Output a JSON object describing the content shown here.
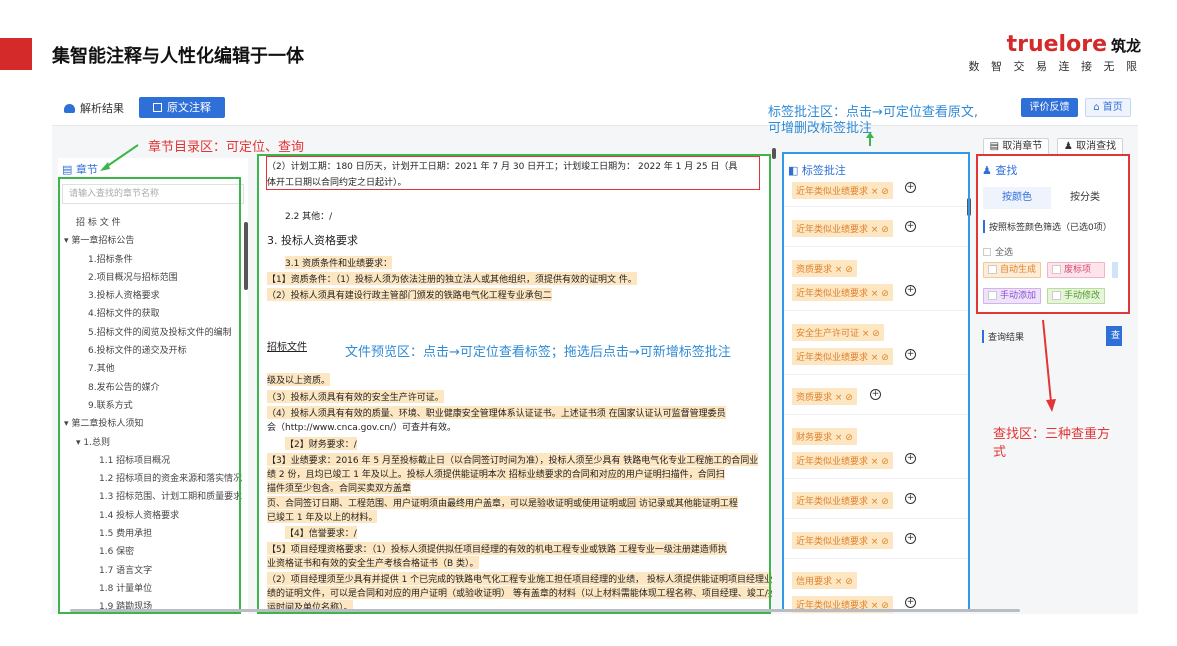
{
  "slide": {
    "title": "集智能注释与人性化编辑于一体",
    "logo_brand": "truelore",
    "logo_cn": "筑龙",
    "logo_slogan": "数 智 交 易  连 接 无 限"
  },
  "app": {
    "tab_analysis": "解析结果",
    "tab_annotate": "原文注释",
    "feedback": "评价反馈",
    "home": "首页",
    "cancel_chapter": "取消章节",
    "cancel_find": "取消查找"
  },
  "annotations": {
    "toc": "章节目录区：可定位、查询",
    "label_line1": "标签批注区：点击→可定位查看原文,",
    "label_line2": "可增删改标签批注",
    "preview": "文件预览区：点击→可定位查看标签；拖选后点击→可新增标签批注",
    "find": "查找区：三种查重方式"
  },
  "sidebar": {
    "title": "章节",
    "search_placeholder": "请输入查找的章节名称",
    "items": [
      "招 标 文 件",
      "▾ 第一章招标公告",
      "1.招标条件",
      "2.项目概况与招标范围",
      "3.投标人资格要求",
      "4.招标文件的获取",
      "5.招标文件的阅览及投标文件的编制",
      "6.投标文件的递交及开标",
      "7.其他",
      "8.发布公告的媒介",
      "9.联系方式",
      "▾ 第二章投标人须知",
      "▾ 1.总则",
      "1.1 招标项目概况",
      "1.2 招标项目的资金来源和落实情况",
      "1.3 招标范围、计划工期和质量要求",
      "1.4 投标人资格要求",
      "1.5 费用承担",
      "1.6 保密",
      "1.7 语言文字",
      "1.8 计量单位",
      "1.9 踏勘现场"
    ]
  },
  "doc": {
    "l1": "（2）计划工期：180 日历天，计划开工日期：2021  年  7  月  30 日开工；计划竣工日期为：  2022  年  1  月  25 日（具",
    "l2": "体开工日期以合同约定之日起计）。",
    "l3": "2.2  其他：/",
    "l4": "3. 投标人资格要求",
    "l5": "3.1  资质条件和业绩要求：",
    "l6": "【1】资质条件：（1）投标人须为依法注册的独立法人或其他组织，须提供有效的证明文 件。",
    "l7": "（2）投标人须具有建设行政主管部门颁发的铁路电气化工程专业承包二",
    "l8": "招标文件",
    "l9": "级及以上资质。",
    "l10": "（3）投标人须具有有效的安全生产许可证。",
    "l11": "（4）投标人须具有有效的质量、环境、职业健康安全管理体系认证证书。上述证书须  在国家认证认可监督管理委员",
    "l12": "会（http://www.cnca.gov.cn/）可查并有效。",
    "l13": "【2】财务要求：/",
    "l14": "【3】业绩要求：2016  年  5  月至投标截止日（以合同签订时间为准），投标人须至少具有  铁路电气化专业工程施工的合同业",
    "l15": "绩  2  份，且均已竣工  1  年及以上。投标人须提供能证明本次  招标业绩要求的合同和对应的用户证明扫描件，合同扫",
    "l16": "描件须至少包含。合同买卖双方盖章",
    "l17": "页、合同签订日期、工程范围、用户证明须由最终用户盖章，可以是验收证明或使用证明或回  访记录或其他能证明工程",
    "l18": "已竣工  1  年及以上的材料。",
    "l19": "【4】信誉要求：/",
    "l20": "【5】项目经理资格要求：（1）投标人须提供拟任项目经理的有效的机电工程专业或铁路  工程专业一级注册建造师执",
    "l21": "业资格证书和有效的安全生产考核合格证书（B  类）。",
    "l22": "（2）项目经理须至少具有并提供  1  个已完成的铁路电气化工程专业施工担任项目经理的业绩，  投标人须提供能证明项目经理业",
    "l23": "绩的证明文件，可以是合同和对应的用户证明（或验收证明）  等有盖章的材料（以上材料需能体现工程名称、项目经理、竣工/投",
    "l24": "运时间及单位名称）。"
  },
  "labels": {
    "title": "标签批注",
    "t1": "近年类似业绩要求",
    "t2": "近年类似业绩要求",
    "t3": "资质要求",
    "t4": "近年类似业绩要求",
    "t5": "安全生产许可证",
    "t6": "近年类似业绩要求",
    "t7": "资质要求",
    "t8": "财务要求",
    "t9": "近年类似业绩要求",
    "t10": "近年类似业绩要求",
    "t11": "近年类似业绩要求",
    "t12": "信用要求",
    "t13": "近年类似业绩要求",
    "suffix": "× ⊘"
  },
  "find": {
    "title": "查找",
    "tab_color": "按颜色",
    "tab_category": "按分类",
    "filter_label": "按照标签颜色筛选（已选0项）",
    "select_all": "全选",
    "chips": [
      "自动生成",
      "废标项",
      "手动添加",
      "手动修改"
    ],
    "result_label": "查询结果",
    "result_btn": "查"
  }
}
